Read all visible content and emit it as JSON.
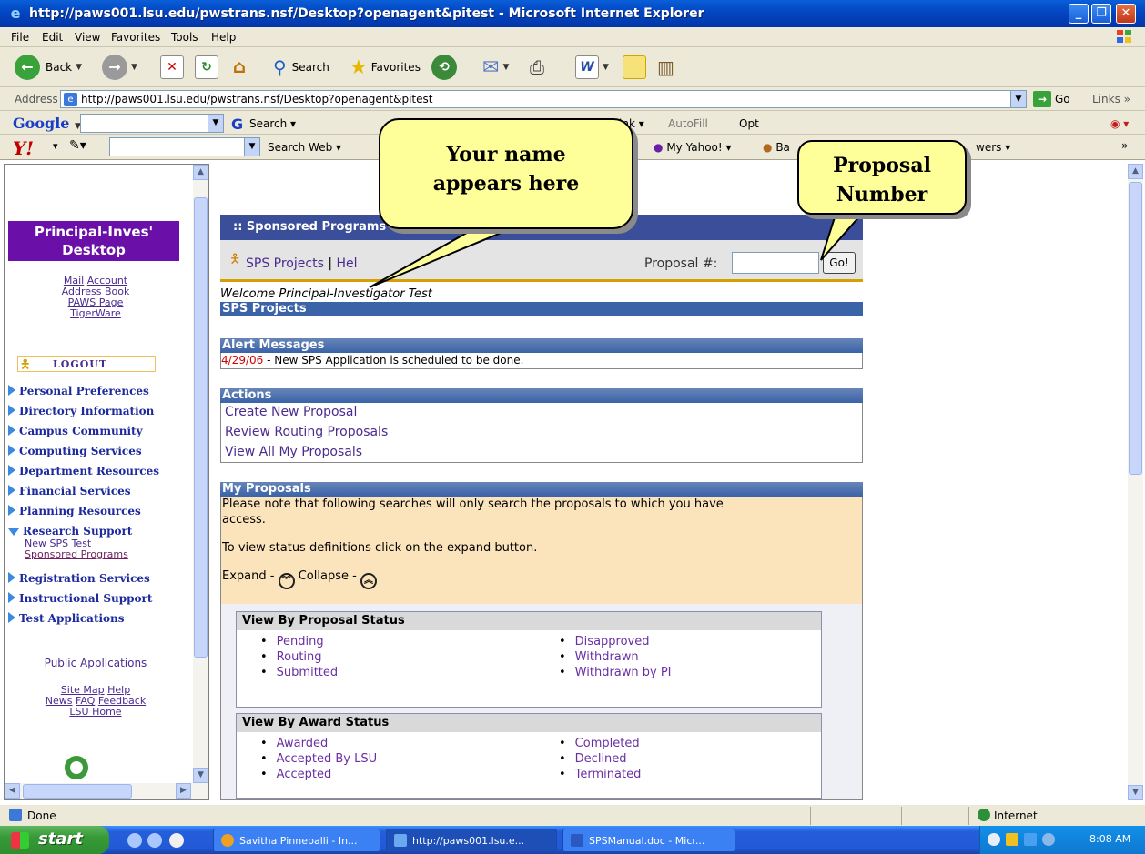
{
  "window": {
    "title": "http://paws001.lsu.edu/pwstrans.nsf/Desktop?openagent&pitest - Microsoft Internet Explorer"
  },
  "menu": [
    "File",
    "Edit",
    "View",
    "Favorites",
    "Tools",
    "Help"
  ],
  "toolbar": {
    "back": "Back",
    "search": "Search",
    "favorites": "Favorites"
  },
  "address": {
    "label": "Address",
    "url": "http://paws001.lsu.edu/pwstrans.nsf/Desktop?openagent&pitest",
    "go": "Go",
    "links": "Links"
  },
  "googlebar": {
    "logo": "Google",
    "search": "Search",
    "link": "ink",
    "autofill": "AutoFill",
    "options": "Opt"
  },
  "yahoobar": {
    "logo": "Y!",
    "search_web": "Search Web",
    "my_yahoo": "My Yahoo!",
    "ba": "Ba",
    "wers": "wers"
  },
  "sidebar": {
    "header": "Principal-Inves' Desktop",
    "top_links": [
      "Mail",
      "Account",
      "Address Book",
      "PAWS Page",
      "TigerWare"
    ],
    "logout": "LOGOUT",
    "nav": [
      "Personal Preferences",
      "Directory Information",
      "Campus Community",
      "Computing Services",
      "Department Resources",
      "Financial Services",
      "Planning Resources",
      "Research Support",
      "Registration Services",
      "Instructional Support",
      "Test Applications"
    ],
    "research_sub": [
      "New SPS Test",
      "Sponsored Programs"
    ],
    "public_apps": "Public Applications",
    "bottom_links": [
      "Site Map",
      "Help",
      "News",
      "FAQ",
      "Feedback",
      "LSU Home"
    ]
  },
  "main": {
    "header": ":: Sponsored Programs S",
    "sps_projects_link": "SPS Projects",
    "separator": "|",
    "help_link": "Hel",
    "proposal_label": "Proposal #:",
    "go_button": "Go!",
    "welcome": "Welcome Principal-Investigator Test",
    "sps_projects_bar": "SPS Projects",
    "alert_title": "Alert Messages",
    "alert_date": "4/29/06",
    "alert_text": " - New SPS Application is scheduled to be done.",
    "actions_title": "Actions",
    "actions": [
      "Create New Proposal",
      "Review Routing Proposals",
      "View All My Proposals"
    ],
    "my_proposals_title": "My Proposals",
    "note_line1": "Please note that following searches will only search the proposals to which you have",
    "note_line2": "access.",
    "note_line3": "To view status definitions click on the expand button.",
    "expand": "Expand -",
    "collapse": "Collapse -",
    "proposal_status_title": "View By Proposal Status",
    "proposal_status_col1": [
      "Pending",
      "Routing",
      "Submitted"
    ],
    "proposal_status_col2": [
      "Disapproved",
      "Withdrawn",
      "Withdrawn by PI"
    ],
    "award_status_title": "View By Award Status",
    "award_status_col1": [
      "Awarded",
      "Accepted By LSU",
      "Accepted"
    ],
    "award_status_col2": [
      "Completed",
      "Declined",
      "Terminated"
    ]
  },
  "callouts": {
    "name": "Your name appears here",
    "proposal": "Proposal Number"
  },
  "statusbar": {
    "done": "Done",
    "zone": "Internet"
  },
  "taskbar": {
    "start": "start",
    "tasks": [
      "Savitha Pinnepalli - In...",
      "http://paws001.lsu.e...",
      "SPSManual.doc - Micr..."
    ],
    "time": "8:08 AM"
  }
}
